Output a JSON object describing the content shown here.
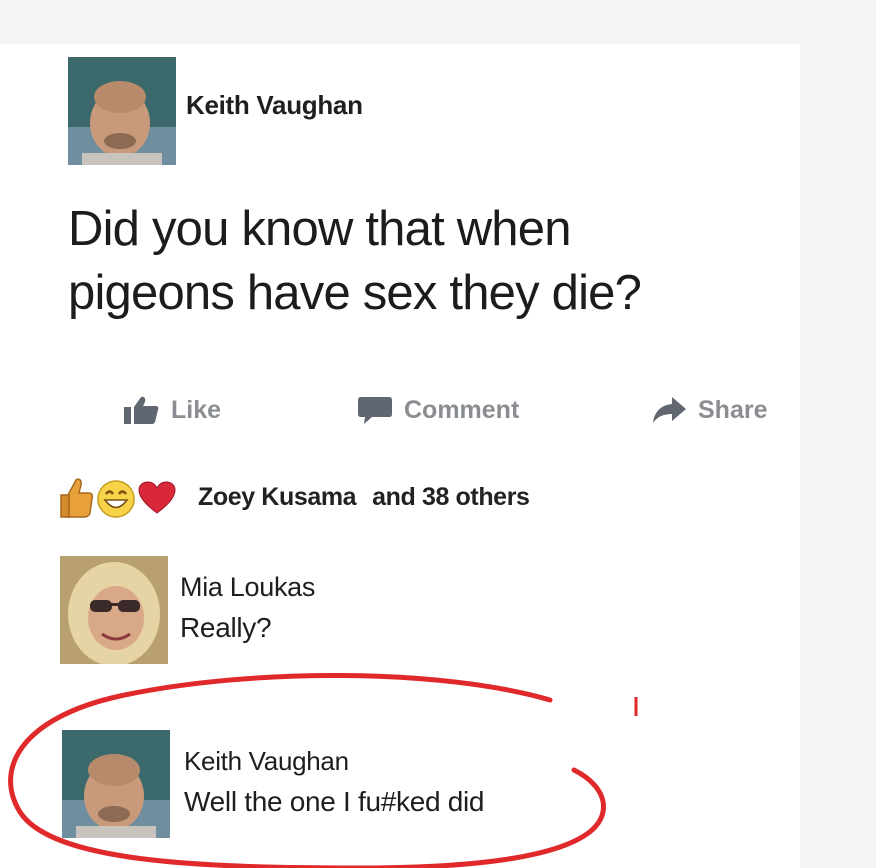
{
  "post": {
    "author": "Keith Vaughan",
    "text_line1": "Did you know that when",
    "text_line2": "pigeons have sex they die?"
  },
  "actions": {
    "like": "Like",
    "comment": "Comment",
    "share": "Share"
  },
  "reactions": {
    "icons": [
      "thumbs-up-icon",
      "grinning-face-icon",
      "heart-icon"
    ],
    "names": "Zoey Kusama",
    "others": "and 38 others"
  },
  "comments": [
    {
      "author": "Mia Loukas",
      "text": "Really?"
    },
    {
      "author": "Keith Vaughan",
      "text": "Well the one I fu#ked did"
    }
  ],
  "colors": {
    "annotation": "#e0292b",
    "action_gray": "#8a8d91",
    "like_blue_gray": "#606770"
  }
}
